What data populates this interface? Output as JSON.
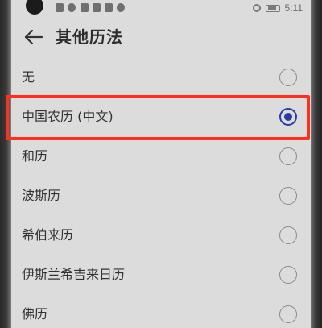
{
  "status_bar": {
    "time": "5:11"
  },
  "header": {
    "title": "其他历法"
  },
  "options": [
    {
      "label": "无",
      "selected": false
    },
    {
      "label": "中国农历 (中文)",
      "selected": true
    },
    {
      "label": "和历",
      "selected": false
    },
    {
      "label": "波斯历",
      "selected": false
    },
    {
      "label": "希伯来历",
      "selected": false
    },
    {
      "label": "伊斯兰希吉来日历",
      "selected": false
    },
    {
      "label": "佛历",
      "selected": false
    }
  ],
  "colors": {
    "accent": "#2b3aa6",
    "highlight": "#ff2f1c"
  }
}
